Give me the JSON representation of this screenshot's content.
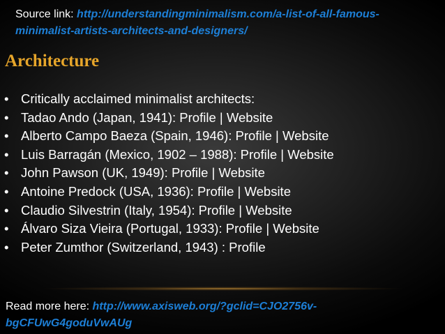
{
  "source": {
    "label": "Source link: ",
    "url_line1": "http://understandingminimalism.com/a-list-of-all-famous-",
    "url_line2": "minimalist-artists-architects-and-designers/"
  },
  "heading": "Architecture",
  "bullets": [
    "Critically acclaimed minimalist architects:",
    "Tadao Ando (Japan, 1941): Profile | Website",
    "Alberto Campo Baeza (Spain, 1946): Profile | Website",
    "Luis Barragán (Mexico, 1902 – 1988): Profile | Website",
    "John Pawson (UK, 1949): Profile | Website",
    "Antoine Predock (USA, 1936): Profile | Website",
    "Claudio Silvestrin (Italy, 1954): Profile | Website",
    "Álvaro Siza Vieira (Portugal, 1933): Profile |  Website",
    "Peter Zumthor (Switzerland, 1943) : Profile"
  ],
  "bullet_marker": "•",
  "read_more": {
    "label": "Read more here: ",
    "url_line1": "http://www.axisweb.org/?gclid=CJO2756v-",
    "url_line2": "bgCFUwG4goduVwAUg"
  },
  "colors": {
    "heading": "#e6a52a",
    "link": "#1d7fd6",
    "text": "#ffffff",
    "background": "#000000"
  }
}
